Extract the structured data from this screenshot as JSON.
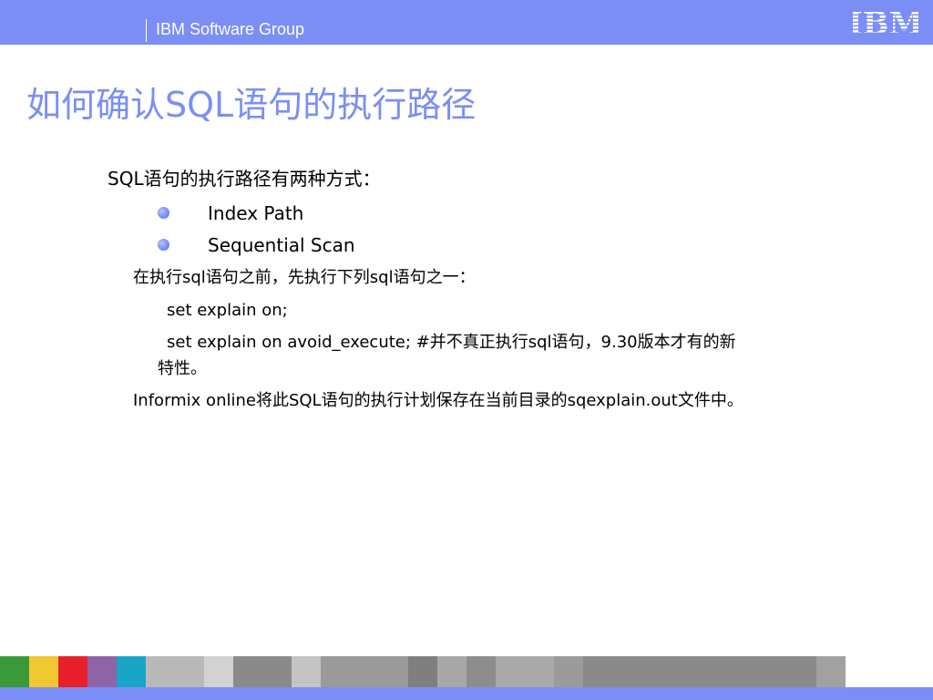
{
  "header": {
    "group_label": "IBM Software Group",
    "logo_text": "IBM"
  },
  "slide": {
    "title": "如何确认SQL语句的执行路径",
    "intro": "SQL语句的执行路径有两种方式：",
    "bullets": [
      "Index Path",
      "Sequential Scan"
    ],
    "before_text": "在执行sql语句之前，先执行下列sql语句之一：",
    "command_1": "set explain on;",
    "command_2_line1": "set explain on avoid_execute;   #并不真正执行sql语句，9.30版本才有的新",
    "command_2_line2": "特性。",
    "result_text": "Informix online将此SQL语句的执行计划保存在当前目录的sqexplain.out文件中。"
  },
  "colors": {
    "brand_blue": "#7b8ef5",
    "text": "#000000",
    "footer_tiles": [
      "#3a9a3a",
      "#f2c830",
      "#e8202c",
      "#8e63a8",
      "#1aa5c8",
      "#b9b9b9",
      "#d2d2d2",
      "#8a8a8a",
      "#c4c4c4",
      "#9a9a9a",
      "#7f7f7f",
      "#a8a8a8",
      "#8d8d8d",
      "#a9a9a9",
      "#9b9b9b",
      "#8a8a8a",
      "#a1a1a1"
    ]
  }
}
